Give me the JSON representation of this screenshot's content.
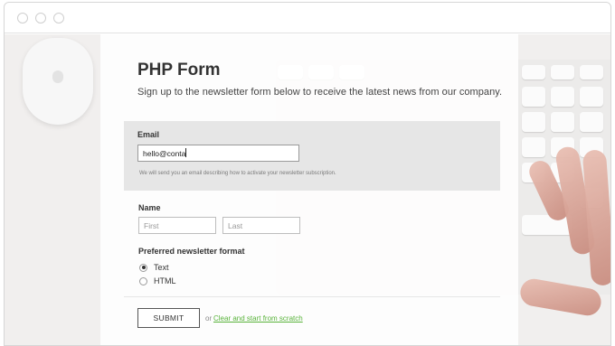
{
  "form": {
    "title": "PHP Form",
    "subtitle": "Sign up to the newsletter form below to receive the latest news from our company.",
    "email": {
      "label": "Email",
      "value": "hello@conta",
      "help": "We will send you an email describing how to activate your newsletter subscription."
    },
    "name": {
      "label": "Name",
      "first_placeholder": "First",
      "last_placeholder": "Last"
    },
    "format": {
      "label": "Preferred newsletter format",
      "options": [
        {
          "label": "Text",
          "selected": true
        },
        {
          "label": "HTML",
          "selected": false
        }
      ]
    },
    "submit_label": "SUBMIT",
    "or_text": "or",
    "clear_link": "Clear and start from scratch"
  },
  "colors": {
    "link": "#58b33a",
    "email_block_bg": "#e2e2e2"
  }
}
